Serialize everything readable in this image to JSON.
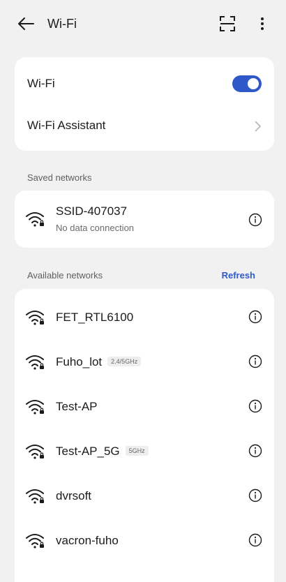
{
  "header": {
    "title": "Wi-Fi"
  },
  "main_card": {
    "wifi_label": "Wi-Fi",
    "wifi_enabled": true,
    "assistant_label": "Wi-Fi Assistant"
  },
  "saved": {
    "section_label": "Saved networks",
    "network": {
      "name": "SSID-407037",
      "status": "No data connection"
    }
  },
  "available": {
    "section_label": "Available networks",
    "refresh_label": "Refresh",
    "networks": [
      {
        "name": "FET_RTL6100",
        "badge": ""
      },
      {
        "name": "Fuho_lot",
        "badge": "2.4/5GHz"
      },
      {
        "name": "Test-AP",
        "badge": ""
      },
      {
        "name": "Test-AP_5G",
        "badge": "5GHz"
      },
      {
        "name": "dvrsoft",
        "badge": ""
      },
      {
        "name": "vacron-fuho",
        "badge": ""
      }
    ]
  },
  "colors": {
    "accent": "#2f58c9",
    "background": "#f1f1f1",
    "card": "#ffffff"
  },
  "icons": [
    "back-arrow-icon",
    "scan-icon",
    "more-icon",
    "chevron-right-icon",
    "wifi-lock-icon",
    "info-icon"
  ]
}
